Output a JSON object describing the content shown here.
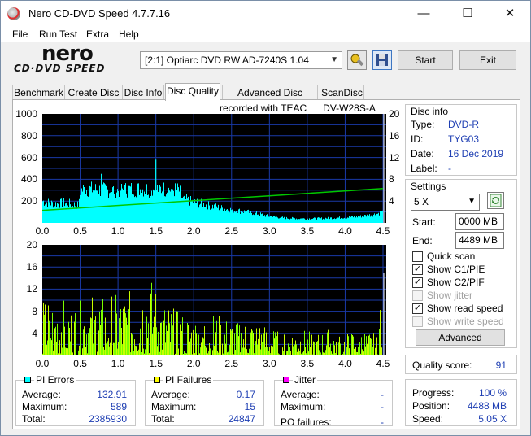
{
  "window": {
    "title": "Nero CD-DVD Speed 4.7.7.16"
  },
  "menu": [
    "File",
    "Run Test",
    "Extra",
    "Help"
  ],
  "logo": {
    "line1": "nero",
    "line2": "CD·DVD SPEED"
  },
  "drive": {
    "selected": "[2:1]  Optiarc DVD RW AD-7240S 1.04"
  },
  "buttons": {
    "start": "Start",
    "exit": "Exit",
    "advanced": "Advanced"
  },
  "tabs": [
    "Benchmark",
    "Create Disc",
    "Disc Info",
    "Disc Quality",
    "Advanced Disc Quality",
    "ScanDisc"
  ],
  "active_tab": "Disc Quality",
  "recorded_with": "recorded with TEAC      DV-W28S-A",
  "disc_info": {
    "heading": "Disc info",
    "type_label": "Type:",
    "type": "DVD-R",
    "id_label": "ID:",
    "id": "TYG03",
    "date_label": "Date:",
    "date": "16 Dec 2019",
    "label_label": "Label:",
    "label": "-"
  },
  "settings": {
    "heading": "Settings",
    "speed": "5 X",
    "start_label": "Start:",
    "start": "0000 MB",
    "end_label": "End:",
    "end": "4489 MB",
    "quick_scan": {
      "label": "Quick scan",
      "checked": false,
      "enabled": true
    },
    "show_c1pie": {
      "label": "Show C1/PIE",
      "checked": true,
      "enabled": true
    },
    "show_c2pif": {
      "label": "Show C2/PIF",
      "checked": true,
      "enabled": true
    },
    "show_jitter": {
      "label": "Show jitter",
      "checked": false,
      "enabled": false
    },
    "show_read_speed": {
      "label": "Show read speed",
      "checked": true,
      "enabled": true
    },
    "show_write_speed": {
      "label": "Show write speed",
      "checked": false,
      "enabled": false
    }
  },
  "quality": {
    "label": "Quality score:",
    "value": "91"
  },
  "progress": {
    "progress_label": "Progress:",
    "progress": "100 %",
    "position_label": "Position:",
    "position": "4488 MB",
    "speed_label": "Speed:",
    "speed": "5.05 X"
  },
  "pi_errors": {
    "title": "PI Errors",
    "color": "#00ffff",
    "average_label": "Average:",
    "average": "132.91",
    "maximum_label": "Maximum:",
    "maximum": "589",
    "total_label": "Total:",
    "total": "2385930"
  },
  "pi_failures": {
    "title": "PI Failures",
    "color": "#ffff00",
    "average_label": "Average:",
    "average": "0.17",
    "maximum_label": "Maximum:",
    "maximum": "15",
    "total_label": "Total:",
    "total": "24847"
  },
  "jitter": {
    "title": "Jitter",
    "color": "#ff00ff",
    "average_label": "Average:",
    "average": "-",
    "maximum_label": "Maximum:",
    "maximum": "-",
    "po_failures_label": "PO failures:",
    "po_failures": "-"
  },
  "chart_data": [
    {
      "type": "area",
      "name": "upper",
      "x_ticks": [
        "0.0",
        "0.5",
        "1.0",
        "1.5",
        "2.0",
        "2.5",
        "3.0",
        "3.5",
        "4.0",
        "4.5"
      ],
      "y_left_ticks": [
        "1000",
        "800",
        "600",
        "400",
        "200"
      ],
      "y_right_ticks": [
        "20",
        "16",
        "12",
        "8",
        "4"
      ],
      "xlim": [
        0,
        4.5
      ],
      "ylim_left": [
        0,
        1000
      ],
      "ylim_right": [
        0,
        20
      ],
      "grid": true,
      "pi_errors_color": "#00ffff",
      "pi_errors_profile": [
        [
          0.0,
          200
        ],
        [
          0.1,
          180
        ],
        [
          0.2,
          175
        ],
        [
          0.3,
          185
        ],
        [
          0.4,
          170
        ],
        [
          0.48,
          160
        ],
        [
          0.5,
          300
        ],
        [
          0.6,
          310
        ],
        [
          0.8,
          300
        ],
        [
          1.0,
          300
        ],
        [
          1.2,
          310
        ],
        [
          1.4,
          310
        ],
        [
          1.6,
          310
        ],
        [
          1.8,
          300
        ],
        [
          1.85,
          220
        ],
        [
          2.0,
          190
        ],
        [
          2.2,
          160
        ],
        [
          2.4,
          130
        ],
        [
          2.6,
          110
        ],
        [
          2.8,
          90
        ],
        [
          3.0,
          60
        ],
        [
          3.2,
          45
        ],
        [
          3.4,
          40
        ],
        [
          3.6,
          40
        ],
        [
          3.8,
          45
        ],
        [
          4.0,
          50
        ],
        [
          4.2,
          60
        ],
        [
          4.4,
          80
        ],
        [
          4.48,
          100
        ]
      ],
      "pi_errors_spikes": [
        [
          0.78,
          450
        ],
        [
          1.5,
          580
        ]
      ],
      "read_speed_color": "#00c800",
      "read_speed_line": [
        [
          0.0,
          2.3
        ],
        [
          4.5,
          6.3
        ]
      ]
    },
    {
      "type": "bar",
      "name": "lower",
      "x_ticks": [
        "0.0",
        "0.5",
        "1.0",
        "1.5",
        "2.0",
        "2.5",
        "3.0",
        "3.5",
        "4.0",
        "4.5"
      ],
      "y_ticks": [
        "20",
        "16",
        "12",
        "8",
        "4"
      ],
      "xlim": [
        0,
        4.5
      ],
      "ylim": [
        0,
        20
      ],
      "grid": true,
      "pi_failures_color": "#7aff00",
      "pi_failures_envelope": [
        [
          0.0,
          10
        ],
        [
          0.2,
          11
        ],
        [
          0.4,
          9
        ],
        [
          0.6,
          11
        ],
        [
          0.8,
          12
        ],
        [
          1.0,
          11
        ],
        [
          1.2,
          12
        ],
        [
          1.4,
          15
        ],
        [
          1.6,
          10
        ],
        [
          1.8,
          8
        ],
        [
          2.0,
          7
        ],
        [
          2.2,
          8
        ],
        [
          2.4,
          7
        ],
        [
          2.6,
          6
        ],
        [
          2.8,
          7
        ],
        [
          3.0,
          5
        ],
        [
          3.2,
          4
        ],
        [
          3.4,
          5
        ],
        [
          3.6,
          4
        ],
        [
          3.8,
          5
        ],
        [
          4.0,
          4
        ],
        [
          4.2,
          5
        ],
        [
          4.4,
          4
        ],
        [
          4.48,
          15
        ]
      ]
    }
  ]
}
